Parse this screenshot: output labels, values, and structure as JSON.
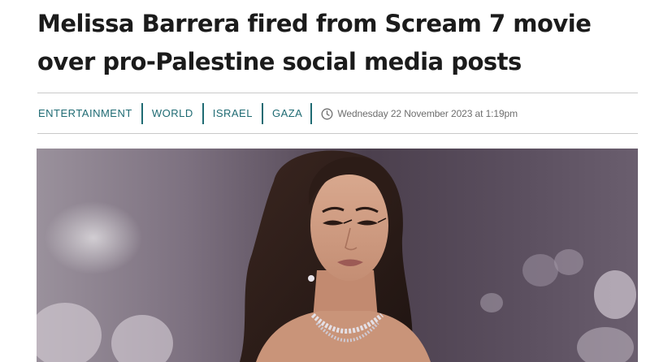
{
  "article": {
    "headline": "Melissa Barrera fired from Scream 7 movie over pro-Palestine social media posts",
    "tags": [
      {
        "label": "ENTERTAINMENT"
      },
      {
        "label": "WORLD"
      },
      {
        "label": "ISRAEL"
      },
      {
        "label": "GAZA"
      }
    ],
    "published": "Wednesday 22 November 2023 at 1:19pm"
  },
  "icons": {
    "clock": "clock-icon"
  },
  "colors": {
    "tag_accent": "#1f6b73",
    "headline": "#1b1b1b",
    "meta_text": "#6e6e6e",
    "divider": "#c9c9c9"
  }
}
